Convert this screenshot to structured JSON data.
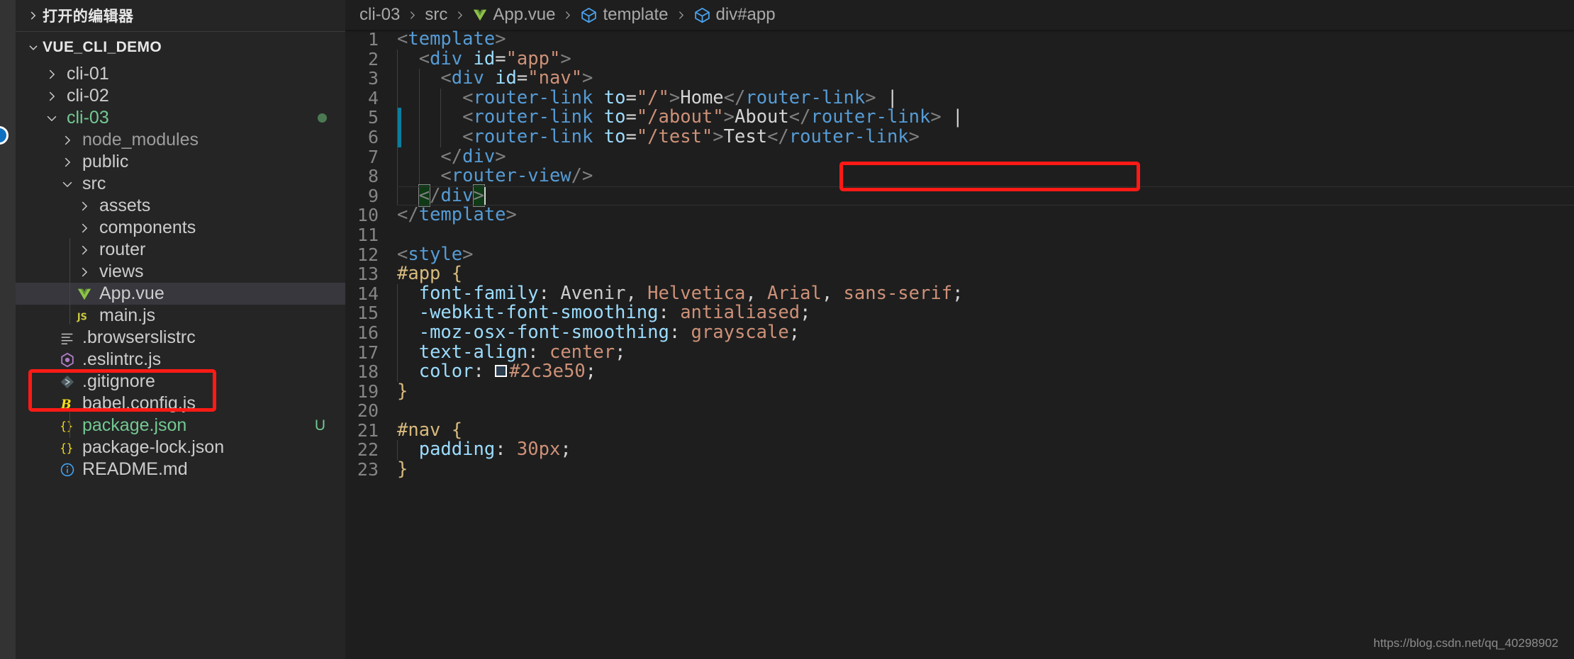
{
  "activity_bar": {
    "badge_name": "source-control-badge"
  },
  "sidebar": {
    "open_editors_label": "打开的编辑器",
    "workspace_label": "VUE_CLI_DEMO",
    "items": [
      {
        "label": "cli-01",
        "icon": "chevron-right-icon",
        "indent": 1,
        "type": "folder"
      },
      {
        "label": "cli-02",
        "icon": "chevron-right-icon",
        "indent": 1,
        "type": "folder"
      },
      {
        "label": "cli-03",
        "icon": "chevron-down-icon",
        "indent": 1,
        "type": "folder",
        "color": "#73c991",
        "dot": true
      },
      {
        "label": "node_modules",
        "icon": "chevron-right-icon",
        "indent": 2,
        "type": "folder",
        "color": "#9d9d9d"
      },
      {
        "label": "public",
        "icon": "chevron-right-icon",
        "indent": 2,
        "type": "folder"
      },
      {
        "label": "src",
        "icon": "chevron-down-icon",
        "indent": 2,
        "type": "folder"
      },
      {
        "label": "assets",
        "icon": "chevron-right-icon",
        "indent": 3,
        "type": "folder"
      },
      {
        "label": "components",
        "icon": "chevron-right-icon",
        "indent": 3,
        "type": "folder"
      },
      {
        "label": "router",
        "icon": "chevron-right-icon",
        "indent": 3,
        "type": "folder"
      },
      {
        "label": "views",
        "icon": "chevron-right-icon",
        "indent": 3,
        "type": "folder"
      },
      {
        "label": "App.vue",
        "icon": "vue-file-icon",
        "indent": 3,
        "type": "file",
        "selected": true
      },
      {
        "label": "main.js",
        "icon": "js-file-icon",
        "indent": 3,
        "type": "file"
      },
      {
        "label": ".browserslistrc",
        "icon": "settings-list-icon",
        "indent": 2,
        "type": "file"
      },
      {
        "label": ".eslintrc.js",
        "icon": "eslint-icon",
        "indent": 2,
        "type": "file"
      },
      {
        "label": ".gitignore",
        "icon": "git-icon",
        "indent": 2,
        "type": "file"
      },
      {
        "label": "babel.config.js",
        "icon": "babel-icon",
        "indent": 2,
        "type": "file"
      },
      {
        "label": "package.json",
        "icon": "json-braces-icon",
        "indent": 2,
        "type": "file",
        "color": "#73c991",
        "badge": "U"
      },
      {
        "label": "package-lock.json",
        "icon": "json-braces-icon",
        "indent": 2,
        "type": "file"
      },
      {
        "label": "README.md",
        "icon": "info-circle-icon",
        "indent": 2,
        "type": "file"
      }
    ]
  },
  "breadcrumbs": [
    {
      "label": "cli-03",
      "icon": null
    },
    {
      "label": "src",
      "icon": null
    },
    {
      "label": "App.vue",
      "icon": "vue-file-icon"
    },
    {
      "label": "template",
      "icon": "symbol-cube-icon"
    },
    {
      "label": "div#app",
      "icon": "symbol-cube-icon"
    }
  ],
  "editor": {
    "language": "vue",
    "lines": [
      {
        "n": "1",
        "indent_guides": [],
        "change": false,
        "tokens": [
          {
            "t": "<",
            "c": "t-bracket"
          },
          {
            "t": "template",
            "c": "t-tag"
          },
          {
            "t": ">",
            "c": "t-bracket"
          }
        ]
      },
      {
        "n": "2",
        "indent_guides": [
          0
        ],
        "change": false,
        "tokens": [
          {
            "t": "  ",
            "c": "t-punc"
          },
          {
            "t": "<",
            "c": "t-bracket"
          },
          {
            "t": "div",
            "c": "t-tag"
          },
          {
            "t": " ",
            "c": "t-punc"
          },
          {
            "t": "id",
            "c": "t-attr"
          },
          {
            "t": "=",
            "c": "t-punc"
          },
          {
            "t": "\"app\"",
            "c": "t-string"
          },
          {
            "t": ">",
            "c": "t-bracket"
          }
        ]
      },
      {
        "n": "3",
        "indent_guides": [
          0,
          1
        ],
        "change": false,
        "tokens": [
          {
            "t": "    ",
            "c": "t-punc"
          },
          {
            "t": "<",
            "c": "t-bracket"
          },
          {
            "t": "div",
            "c": "t-tag"
          },
          {
            "t": " ",
            "c": "t-punc"
          },
          {
            "t": "id",
            "c": "t-attr"
          },
          {
            "t": "=",
            "c": "t-punc"
          },
          {
            "t": "\"nav\"",
            "c": "t-string"
          },
          {
            "t": ">",
            "c": "t-bracket"
          }
        ]
      },
      {
        "n": "4",
        "indent_guides": [
          0,
          1,
          2
        ],
        "change": false,
        "tokens": [
          {
            "t": "      ",
            "c": "t-punc"
          },
          {
            "t": "<",
            "c": "t-bracket"
          },
          {
            "t": "router-link",
            "c": "t-tag"
          },
          {
            "t": " ",
            "c": "t-punc"
          },
          {
            "t": "to",
            "c": "t-attr"
          },
          {
            "t": "=",
            "c": "t-punc"
          },
          {
            "t": "\"/\"",
            "c": "t-string"
          },
          {
            "t": ">",
            "c": "t-bracket"
          },
          {
            "t": "Home",
            "c": "t-text"
          },
          {
            "t": "</",
            "c": "t-bracket"
          },
          {
            "t": "router-link",
            "c": "t-tag"
          },
          {
            "t": ">",
            "c": "t-bracket"
          },
          {
            "t": " |",
            "c": "t-text"
          }
        ]
      },
      {
        "n": "5",
        "indent_guides": [
          0,
          1,
          2
        ],
        "change": true,
        "tokens": [
          {
            "t": "      ",
            "c": "t-punc"
          },
          {
            "t": "<",
            "c": "t-bracket"
          },
          {
            "t": "router-link",
            "c": "t-tag"
          },
          {
            "t": " ",
            "c": "t-punc"
          },
          {
            "t": "to",
            "c": "t-attr"
          },
          {
            "t": "=",
            "c": "t-punc"
          },
          {
            "t": "\"/about\"",
            "c": "t-string"
          },
          {
            "t": ">",
            "c": "t-bracket"
          },
          {
            "t": "About",
            "c": "t-text"
          },
          {
            "t": "</",
            "c": "t-bracket"
          },
          {
            "t": "router-link",
            "c": "t-tag"
          },
          {
            "t": ">",
            "c": "t-bracket"
          },
          {
            "t": " |",
            "c": "t-text"
          }
        ]
      },
      {
        "n": "6",
        "indent_guides": [
          0,
          1,
          2
        ],
        "change": true,
        "tokens": [
          {
            "t": "      ",
            "c": "t-punc"
          },
          {
            "t": "<",
            "c": "t-bracket"
          },
          {
            "t": "router-link",
            "c": "t-tag"
          },
          {
            "t": " ",
            "c": "t-punc"
          },
          {
            "t": "to",
            "c": "t-attr"
          },
          {
            "t": "=",
            "c": "t-punc"
          },
          {
            "t": "\"/test\"",
            "c": "t-string"
          },
          {
            "t": ">",
            "c": "t-bracket"
          },
          {
            "t": "Test",
            "c": "t-text"
          },
          {
            "t": "</",
            "c": "t-bracket"
          },
          {
            "t": "router-link",
            "c": "t-tag"
          },
          {
            "t": ">",
            "c": "t-bracket"
          }
        ]
      },
      {
        "n": "7",
        "indent_guides": [
          0,
          1
        ],
        "change": false,
        "tokens": [
          {
            "t": "    ",
            "c": "t-punc"
          },
          {
            "t": "</",
            "c": "t-bracket"
          },
          {
            "t": "div",
            "c": "t-tag"
          },
          {
            "t": ">",
            "c": "t-bracket"
          }
        ]
      },
      {
        "n": "8",
        "indent_guides": [
          0,
          1
        ],
        "change": false,
        "tokens": [
          {
            "t": "    ",
            "c": "t-punc"
          },
          {
            "t": "<",
            "c": "t-bracket"
          },
          {
            "t": "router-view",
            "c": "t-tag"
          },
          {
            "t": "/>",
            "c": "t-bracket"
          }
        ]
      },
      {
        "n": "9",
        "indent_guides": [
          0
        ],
        "change": false,
        "tokens": [
          {
            "t": "  ",
            "c": "t-punc"
          },
          {
            "t": "<",
            "c": "t-bracket bracket-match"
          },
          {
            "t": "/",
            "c": "t-bracket"
          },
          {
            "t": "div",
            "c": "t-tag"
          },
          {
            "t": ">",
            "c": "t-bracket bracket-match"
          }
        ],
        "cursor": true,
        "current": true
      },
      {
        "n": "10",
        "indent_guides": [],
        "change": false,
        "tokens": [
          {
            "t": "</",
            "c": "t-bracket"
          },
          {
            "t": "template",
            "c": "t-tag"
          },
          {
            "t": ">",
            "c": "t-bracket"
          }
        ]
      },
      {
        "n": "11",
        "indent_guides": [],
        "change": false,
        "tokens": []
      },
      {
        "n": "12",
        "indent_guides": [],
        "change": false,
        "tokens": [
          {
            "t": "<",
            "c": "t-bracket"
          },
          {
            "t": "style",
            "c": "t-tag"
          },
          {
            "t": ">",
            "c": "t-bracket"
          }
        ]
      },
      {
        "n": "13",
        "indent_guides": [],
        "change": false,
        "tokens": [
          {
            "t": "#app",
            "c": "t-selector"
          },
          {
            "t": " ",
            "c": "t-punc"
          },
          {
            "t": "{",
            "c": "t-selector"
          }
        ]
      },
      {
        "n": "14",
        "indent_guides": [
          0
        ],
        "change": false,
        "tokens": [
          {
            "t": "  ",
            "c": "t-punc"
          },
          {
            "t": "font-family",
            "c": "t-prop"
          },
          {
            "t": ":",
            "c": "t-punc"
          },
          {
            "t": " ",
            "c": "t-punc"
          },
          {
            "t": "Avenir",
            "c": "t-value2"
          },
          {
            "t": ",",
            "c": "t-punc"
          },
          {
            "t": " ",
            "c": "t-punc"
          },
          {
            "t": "Helvetica",
            "c": "t-value"
          },
          {
            "t": ",",
            "c": "t-punc"
          },
          {
            "t": " ",
            "c": "t-punc"
          },
          {
            "t": "Arial",
            "c": "t-value"
          },
          {
            "t": ",",
            "c": "t-punc"
          },
          {
            "t": " ",
            "c": "t-punc"
          },
          {
            "t": "sans-serif",
            "c": "t-value"
          },
          {
            "t": ";",
            "c": "t-punc"
          }
        ]
      },
      {
        "n": "15",
        "indent_guides": [
          0
        ],
        "change": false,
        "tokens": [
          {
            "t": "  ",
            "c": "t-punc"
          },
          {
            "t": "-webkit-font-smoothing",
            "c": "t-prop"
          },
          {
            "t": ":",
            "c": "t-punc"
          },
          {
            "t": " ",
            "c": "t-punc"
          },
          {
            "t": "antialiased",
            "c": "t-value"
          },
          {
            "t": ";",
            "c": "t-punc"
          }
        ]
      },
      {
        "n": "16",
        "indent_guides": [
          0
        ],
        "change": false,
        "tokens": [
          {
            "t": "  ",
            "c": "t-punc"
          },
          {
            "t": "-moz-osx-font-smoothing",
            "c": "t-prop"
          },
          {
            "t": ":",
            "c": "t-punc"
          },
          {
            "t": " ",
            "c": "t-punc"
          },
          {
            "t": "grayscale",
            "c": "t-value"
          },
          {
            "t": ";",
            "c": "t-punc"
          }
        ]
      },
      {
        "n": "17",
        "indent_guides": [
          0
        ],
        "change": false,
        "tokens": [
          {
            "t": "  ",
            "c": "t-punc"
          },
          {
            "t": "text-align",
            "c": "t-prop"
          },
          {
            "t": ":",
            "c": "t-punc"
          },
          {
            "t": " ",
            "c": "t-punc"
          },
          {
            "t": "center",
            "c": "t-value"
          },
          {
            "t": ";",
            "c": "t-punc"
          }
        ]
      },
      {
        "n": "18",
        "indent_guides": [
          0
        ],
        "change": false,
        "swatch": "#2c3e50",
        "tokens": [
          {
            "t": "  ",
            "c": "t-punc"
          },
          {
            "t": "color",
            "c": "t-prop"
          },
          {
            "t": ":",
            "c": "t-punc"
          },
          {
            "t": " ",
            "c": "t-punc"
          }
        ],
        "tokens_after": [
          {
            "t": "#2c3e50",
            "c": "t-value"
          },
          {
            "t": ";",
            "c": "t-punc"
          }
        ]
      },
      {
        "n": "19",
        "indent_guides": [],
        "change": false,
        "tokens": [
          {
            "t": "}",
            "c": "t-selector"
          }
        ]
      },
      {
        "n": "20",
        "indent_guides": [],
        "change": false,
        "tokens": []
      },
      {
        "n": "21",
        "indent_guides": [],
        "change": false,
        "tokens": [
          {
            "t": "#nav",
            "c": "t-selector"
          },
          {
            "t": " ",
            "c": "t-punc"
          },
          {
            "t": "{",
            "c": "t-selector"
          }
        ]
      },
      {
        "n": "22",
        "indent_guides": [
          0
        ],
        "change": false,
        "tokens": [
          {
            "t": "  ",
            "c": "t-punc"
          },
          {
            "t": "padding",
            "c": "t-prop"
          },
          {
            "t": ":",
            "c": "t-punc"
          },
          {
            "t": " ",
            "c": "t-punc"
          },
          {
            "t": "30px",
            "c": "t-value"
          },
          {
            "t": ";",
            "c": "t-punc"
          }
        ]
      },
      {
        "n": "23",
        "indent_guides": [],
        "change": false,
        "tokens": [
          {
            "t": "}",
            "c": "t-selector"
          }
        ]
      }
    ]
  },
  "annotations": [
    {
      "name": "app-vue-file-highlight",
      "color": "#ff1a15"
    },
    {
      "name": "test-router-link-highlight",
      "color": "#ff1a15"
    }
  ],
  "watermark": "https://blog.csdn.net/qq_40298902"
}
